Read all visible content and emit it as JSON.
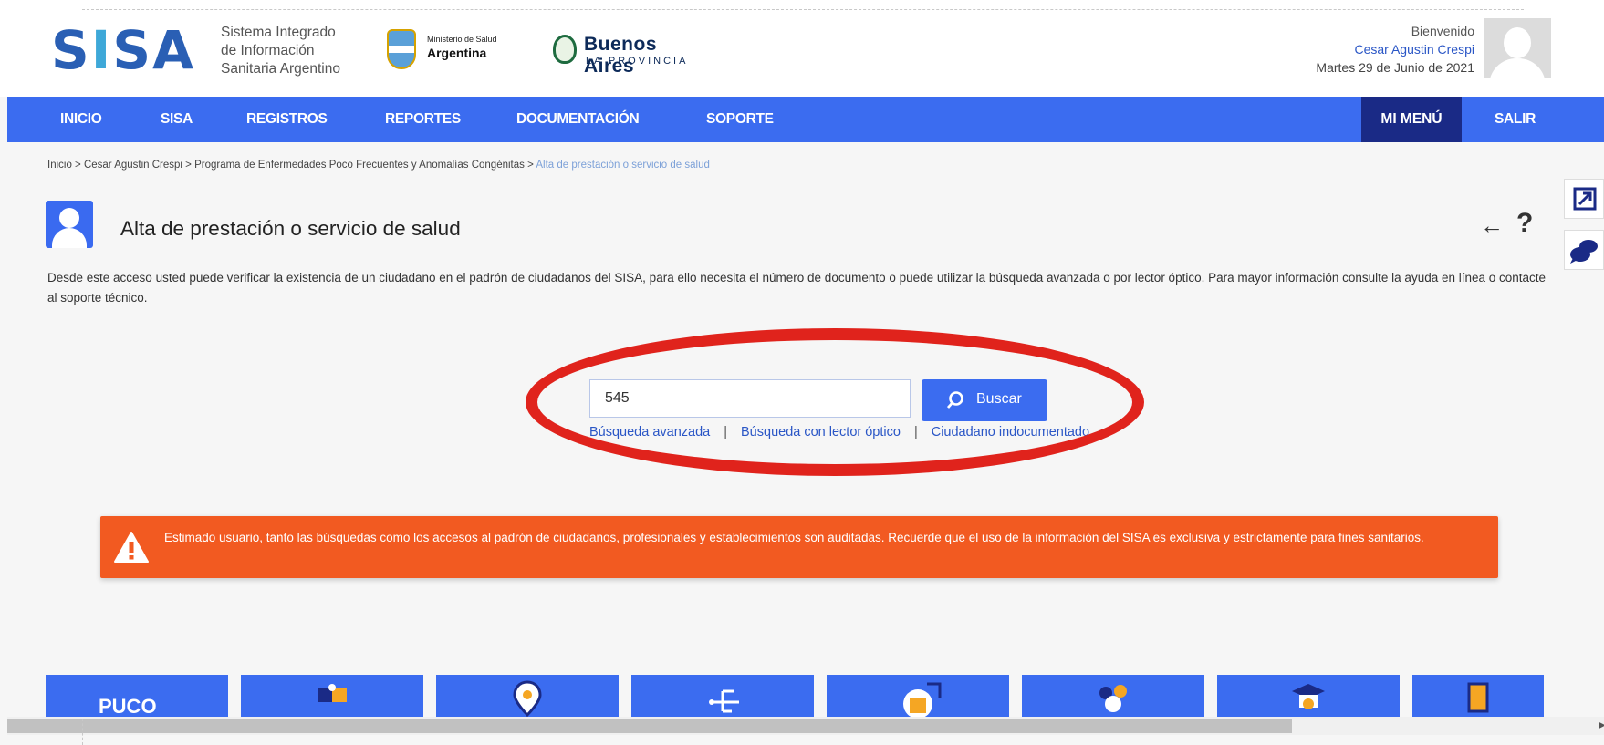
{
  "brand": {
    "logo_text": "SISA",
    "subtitle_lines": [
      "Sistema Integrado",
      "de Información",
      "Sanitaria Argentino"
    ],
    "ministry_small": "Ministerio de Salud",
    "ministry_big": "Argentina",
    "province_big": "Buenos Aires",
    "province_small": "LA PROVINCIA"
  },
  "user": {
    "greeting": "Bienvenido",
    "name": "Cesar Agustin Crespi",
    "date": "Martes 29 de Junio de 2021"
  },
  "nav": {
    "items": [
      "INICIO",
      "SISA",
      "REGISTROS",
      "REPORTES",
      "DOCUMENTACIÓN",
      "SOPORTE"
    ],
    "my_menu": "MI MENÚ",
    "logout": "SALIR"
  },
  "breadcrumb": {
    "path": "Inicio > Cesar Agustin Crespi > Programa de Enfermedades Poco Frecuentes y Anomalías Congénitas > ",
    "current": "Alta de prestación o servicio de salud"
  },
  "page": {
    "title": "Alta de prestación o servicio de salud",
    "description": "Desde este acceso usted puede verificar la existencia de un ciudadano en el padrón de ciudadanos del SISA, para ello necesita el número de documento o puede utilizar la búsqueda avanzada o por lector óptico. Para mayor información consulte la ayuda en línea o contacte al soporte técnico."
  },
  "search": {
    "value": "545",
    "button_label": "Buscar",
    "links": [
      "Búsqueda avanzada",
      "Búsqueda con lector óptico",
      "Ciudadano indocumentado"
    ]
  },
  "alert": {
    "text": "Estimado usuario, tanto las búsquedas como los accesos al padrón de ciudadanos, profesionales y establecimientos son auditadas. Recuerde que el uso de la información del SISA es exclusiva y estrictamente para fines sanitarios."
  },
  "tiles": {
    "first_label": "PUCO",
    "icons": [
      "puzzle-icon",
      "map-pin-icon",
      "tree-structure-icon",
      "building-icon",
      "people-group-icon",
      "graduation-cap-icon",
      "document-icon"
    ]
  },
  "colors": {
    "nav_blue": "#3b6cf0",
    "menu_dark": "#1a2a86",
    "alert_orange": "#f25a21",
    "highlight_red": "#e0231c",
    "link_blue": "#2a56c6"
  }
}
